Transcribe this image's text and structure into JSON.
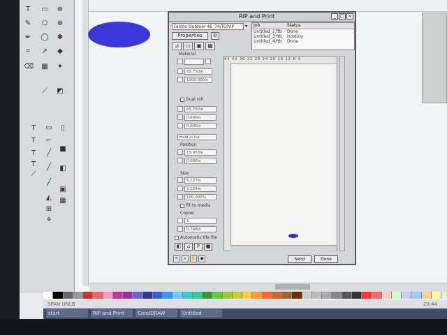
{
  "window": {
    "title": "RIP and Print",
    "minimize": "_",
    "maximize": "□",
    "close": "×"
  },
  "printer": {
    "selected": "Falcon Outdoor 46_74/TCP/IP",
    "arrow": "▾"
  },
  "properties_label": "Properties",
  "job_list": {
    "headers": [
      "Job",
      "Status"
    ],
    "rows": [
      {
        "job": "Untitled_2.ftb",
        "status": "Done"
      },
      {
        "job": "Untitled_3.ftb",
        "status": "Holding"
      },
      {
        "job": "Untitled_4.ftb",
        "status": "Done"
      }
    ]
  },
  "panel": {
    "material_label": "Material",
    "dual_roll_label": "Dual roll",
    "position_label": "Position",
    "size_label": "Size",
    "fit_to_media_label": "Fit to media",
    "copies_label": "Copies",
    "auto_tile_label": "Automatic tile file",
    "hold_label": "Hold in list",
    "fields": {
      "width1": "65.750in",
      "height1": "1200.000in",
      "dr1": "65.750in",
      "dr2": "0.000in",
      "dr3": "0.000in",
      "pos_x": "15.953in",
      "pos_y": "0.000in",
      "size_w": "5.127in",
      "size_h": "2.125in",
      "size_pct": "100.000%",
      "copies": "1",
      "copies2": "0.748in"
    }
  },
  "buttons": {
    "send": "Send",
    "done": "Done"
  },
  "preview_ruler": "44  40  36  32  28  24  20  16  12  8  4",
  "taskbar": {
    "items": [
      "start",
      "RIP and Print",
      "CorelDRAW",
      "Untitled"
    ]
  },
  "status": {
    "left": "SPAN   UNLB",
    "right": "20:44"
  },
  "colors": {
    "ellipse": "#3a38d8",
    "preview_ellipse": "#2c2fd2",
    "taskbar": "#3d4d68"
  }
}
